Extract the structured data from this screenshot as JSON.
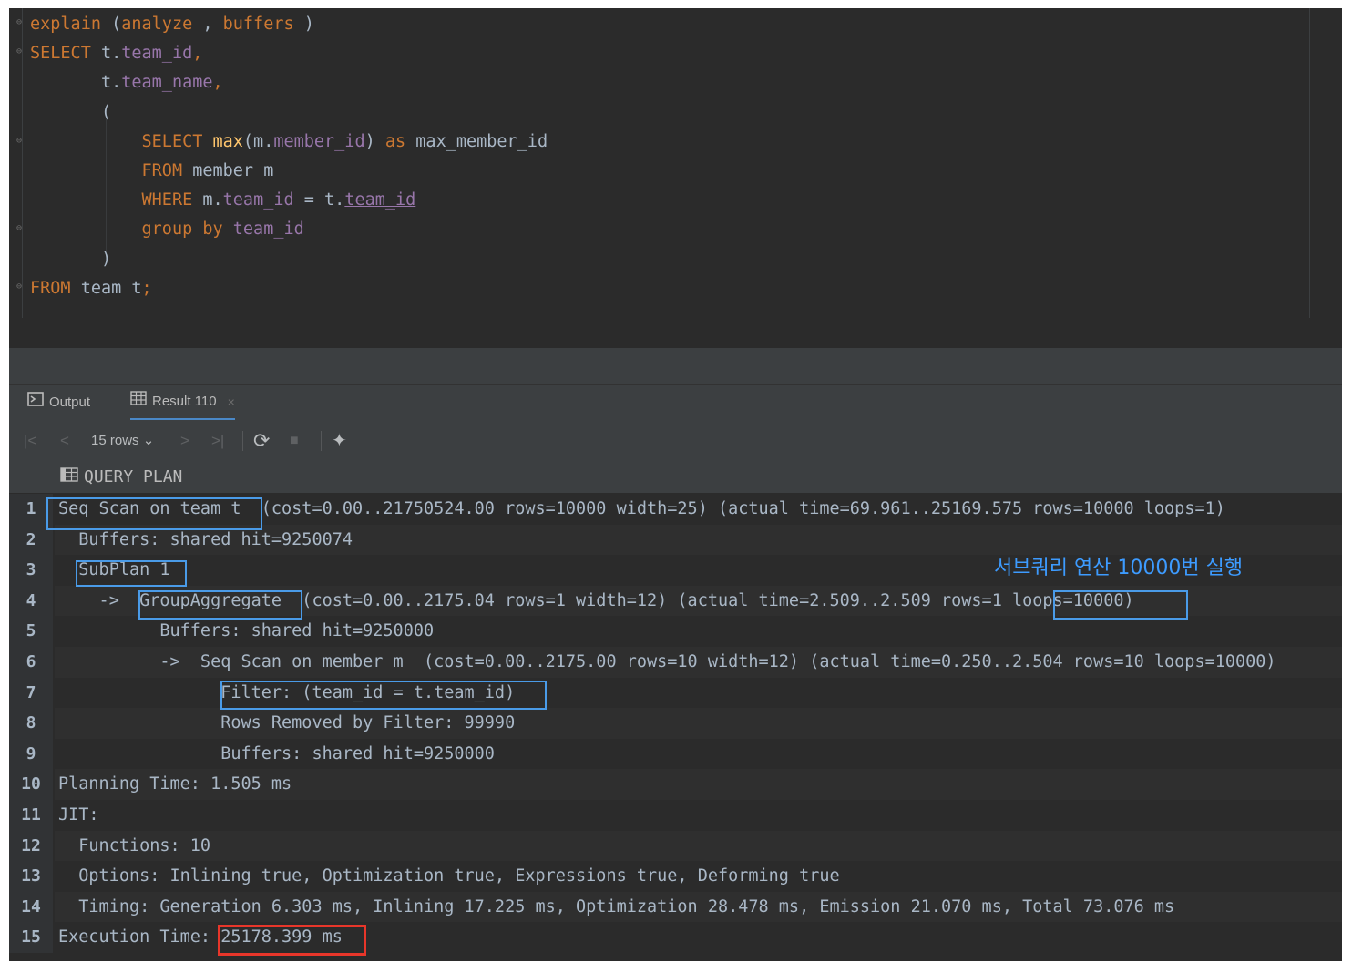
{
  "editor": {
    "lines": [
      [
        {
          "c": "kw",
          "t": "explain"
        },
        {
          "c": "plain",
          "t": " ("
        },
        {
          "c": "kw",
          "t": "analyze"
        },
        {
          "c": "plain",
          "t": " , "
        },
        {
          "c": "kw",
          "t": "buffers"
        },
        {
          "c": "plain",
          "t": " )"
        }
      ],
      [
        {
          "c": "kw",
          "t": "SELECT"
        },
        {
          "c": "plain",
          "t": " t."
        },
        {
          "c": "fld",
          "t": "team_id"
        },
        {
          "c": "kw",
          "t": ","
        }
      ],
      [
        {
          "c": "plain",
          "t": "       t."
        },
        {
          "c": "fld",
          "t": "team_name"
        },
        {
          "c": "kw",
          "t": ","
        }
      ],
      [
        {
          "c": "plain",
          "t": "       ("
        }
      ],
      [
        {
          "c": "plain",
          "t": "           "
        },
        {
          "c": "kw",
          "t": "SELECT"
        },
        {
          "c": "plain",
          "t": " "
        },
        {
          "c": "fn",
          "t": "max"
        },
        {
          "c": "plain",
          "t": "(m."
        },
        {
          "c": "fld",
          "t": "member_id"
        },
        {
          "c": "plain",
          "t": ") "
        },
        {
          "c": "kw",
          "t": "as"
        },
        {
          "c": "plain",
          "t": " max_member_id"
        }
      ],
      [
        {
          "c": "plain",
          "t": "           "
        },
        {
          "c": "kw",
          "t": "FROM"
        },
        {
          "c": "plain",
          "t": " member m"
        }
      ],
      [
        {
          "c": "plain",
          "t": "           "
        },
        {
          "c": "kw",
          "t": "WHERE"
        },
        {
          "c": "plain",
          "t": " m."
        },
        {
          "c": "fld",
          "t": "team_id"
        },
        {
          "c": "plain",
          "t": " = t."
        },
        {
          "c": "ref",
          "t": "team_id"
        }
      ],
      [
        {
          "c": "plain",
          "t": "           "
        },
        {
          "c": "kw",
          "t": "group by"
        },
        {
          "c": "plain",
          "t": " "
        },
        {
          "c": "fld",
          "t": "team_id"
        }
      ],
      [
        {
          "c": "plain",
          "t": "       )"
        }
      ],
      [
        {
          "c": "kw",
          "t": "FROM"
        },
        {
          "c": "plain",
          "t": " team t"
        },
        {
          "c": "kw",
          "t": ";"
        }
      ]
    ]
  },
  "tabs": {
    "output_label": "Output",
    "result_label": "Result 110",
    "close_glyph": "×"
  },
  "toolbar": {
    "rows_label": "15 rows",
    "rows_chevron": "⌄",
    "first_glyph": "|<",
    "prev_glyph": "<",
    "next_glyph": ">",
    "last_glyph": ">|",
    "refresh_glyph": "⟳",
    "stop_glyph": "■",
    "pin_glyph": "✦"
  },
  "grid": {
    "column_header": "QUERY PLAN",
    "rows": [
      {
        "num": "1",
        "text": "Seq Scan on team t  (cost=0.00..21750524.00 rows=10000 width=25) (actual time=69.961..25169.575 rows=10000 loops=1)"
      },
      {
        "num": "2",
        "text": "  Buffers: shared hit=9250074"
      },
      {
        "num": "3",
        "text": "  SubPlan 1"
      },
      {
        "num": "4",
        "text": "    ->  GroupAggregate  (cost=0.00..2175.04 rows=1 width=12) (actual time=2.509..2.509 rows=1 loops=10000)"
      },
      {
        "num": "5",
        "text": "          Buffers: shared hit=9250000"
      },
      {
        "num": "6",
        "text": "          ->  Seq Scan on member m  (cost=0.00..2175.00 rows=10 width=12) (actual time=0.250..2.504 rows=10 loops=10000)"
      },
      {
        "num": "7",
        "text": "                Filter: (team_id = t.team_id)"
      },
      {
        "num": "8",
        "text": "                Rows Removed by Filter: 99990"
      },
      {
        "num": "9",
        "text": "                Buffers: shared hit=9250000"
      },
      {
        "num": "10",
        "text": "Planning Time: 1.505 ms"
      },
      {
        "num": "11",
        "text": "JIT:"
      },
      {
        "num": "12",
        "text": "  Functions: 10"
      },
      {
        "num": "13",
        "text": "  Options: Inlining true, Optimization true, Expressions true, Deforming true"
      },
      {
        "num": "14",
        "text": "  Timing: Generation 6.303 ms, Inlining 17.225 ms, Optimization 28.478 ms, Emission 21.070 ms, Total 73.076 ms"
      },
      {
        "num": "15",
        "text": "Execution Time: 25178.399 ms"
      }
    ]
  },
  "annotation": "서브쿼리 연산 10000번 실행",
  "colors": {
    "highlight_box": "#4a9be8",
    "execution_box": "#e8362a",
    "annotation_text": "#3d9bff"
  }
}
